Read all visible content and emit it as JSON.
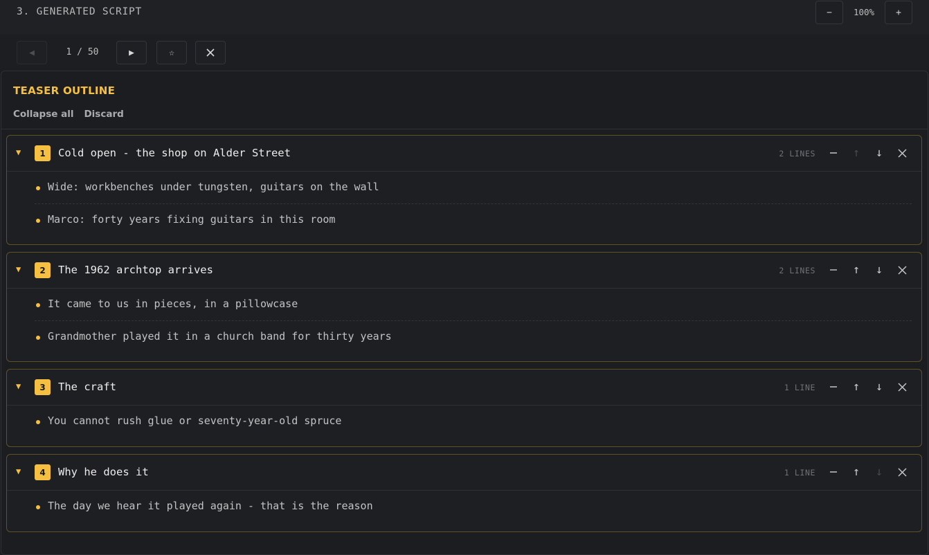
{
  "header": {
    "title": "3. GENERATED SCRIPT",
    "zoom_out": "−",
    "zoom_level": "100%",
    "zoom_in": "+"
  },
  "nav": {
    "prev_icon": "play-reverse-icon",
    "page": "1 / 50",
    "next_icon": "play-icon",
    "star_icon": "star-icon",
    "close_icon": "close-icon"
  },
  "outline": {
    "title": "TEASER OUTLINE",
    "collapse_all": "Collapse all",
    "discard": "Discard",
    "sections": [
      {
        "number": "1",
        "title": "Cold open - the shop on Alder Street",
        "count": "2 LINES",
        "up_disabled": true,
        "down_disabled": false,
        "lines": [
          "Wide: workbenches under tungsten, guitars on the wall",
          "Marco: forty years fixing guitars in this room"
        ]
      },
      {
        "number": "2",
        "title": "The 1962 archtop arrives",
        "count": "2 LINES",
        "up_disabled": false,
        "down_disabled": false,
        "lines": [
          "It came to us in pieces, in a pillowcase",
          "Grandmother played it in a church band for thirty years"
        ]
      },
      {
        "number": "3",
        "title": "The craft",
        "count": "1 LINE",
        "up_disabled": false,
        "down_disabled": false,
        "lines": [
          "You cannot rush glue or seventy-year-old spruce"
        ]
      },
      {
        "number": "4",
        "title": "Why he does it",
        "count": "1 LINE",
        "up_disabled": false,
        "down_disabled": true,
        "lines": [
          "The day we hear it played again - that is the reason"
        ]
      }
    ]
  },
  "colors": {
    "accent": "#f5c042",
    "background": "#1c1d20",
    "section_border": "#5f5226"
  }
}
